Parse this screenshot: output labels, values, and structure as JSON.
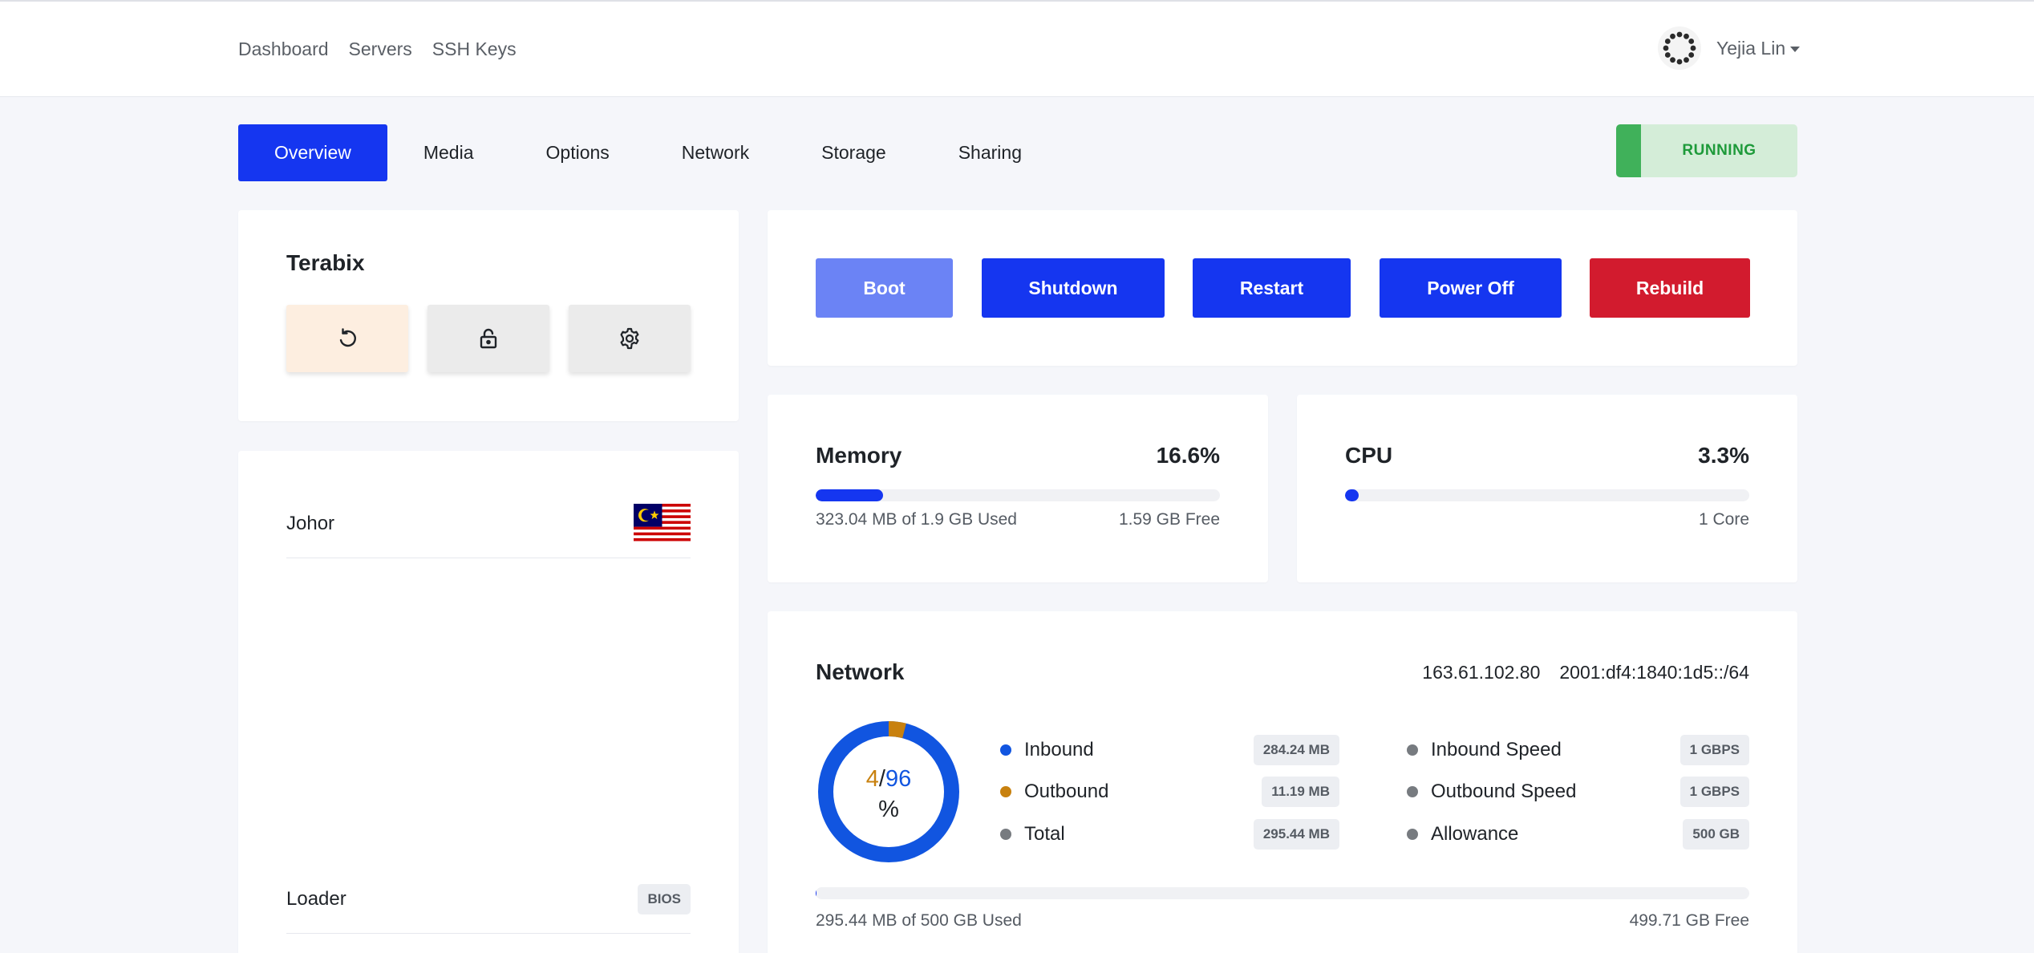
{
  "nav": {
    "links": [
      "Dashboard",
      "Servers",
      "SSH Keys"
    ],
    "user_name": "Yejia Lin"
  },
  "tabs": [
    {
      "label": "Overview",
      "active": true
    },
    {
      "label": "Media"
    },
    {
      "label": "Options"
    },
    {
      "label": "Network"
    },
    {
      "label": "Storage"
    },
    {
      "label": "Sharing"
    }
  ],
  "status": {
    "label": "RUNNING",
    "color": "#40b15a"
  },
  "server": {
    "name": "Terabix",
    "buttons": [
      {
        "icon": "refresh-icon",
        "bg": "#fdeee0"
      },
      {
        "icon": "lock-icon",
        "bg": "#ebebeb"
      },
      {
        "icon": "gear-icon",
        "bg": "#ebebeb"
      }
    ]
  },
  "location": {
    "city": "Johor",
    "flag": "malaysia-flag",
    "loader_label": "Loader",
    "loader_value": "BIOS"
  },
  "actions": [
    {
      "label": "Boot",
      "color": "#6b83f5"
    },
    {
      "label": "Shutdown",
      "color": "#1536f0"
    },
    {
      "label": "Restart",
      "color": "#1536f0"
    },
    {
      "label": "Power Off",
      "color": "#1536f0"
    },
    {
      "label": "Rebuild",
      "color": "#d21b2e"
    }
  ],
  "memory": {
    "title": "Memory",
    "percent_label": "16.6%",
    "fill_fraction": 0.166,
    "used_text": "323.04 MB of 1.9 GB Used",
    "free_text": "1.59 GB Free"
  },
  "cpu": {
    "title": "CPU",
    "percent_label": "3.3%",
    "fill_fraction": 0.033,
    "cores_text": "1 Core"
  },
  "network": {
    "title": "Network",
    "ipv4": "163.61.102.80",
    "ipv6": "2001:df4:1840:1d5::/64",
    "donut": {
      "outbound_pct": 4,
      "inbound_pct": 96,
      "sep": "/",
      "unit": "%",
      "inbound_color": "#1155e0",
      "outbound_color": "#c8810f"
    },
    "traffic": [
      {
        "name": "Inbound",
        "value": "284.24 MB",
        "color": "#1155e0"
      },
      {
        "name": "Outbound",
        "value": "11.19 MB",
        "color": "#c8810f"
      },
      {
        "name": "Total",
        "value": "295.44 MB",
        "color": "#777b80"
      }
    ],
    "limits": [
      {
        "name": "Inbound Speed",
        "value": "1 GBPS",
        "color": "#777b80"
      },
      {
        "name": "Outbound Speed",
        "value": "1 GBPS",
        "color": "#777b80"
      },
      {
        "name": "Allowance",
        "value": "500 GB",
        "color": "#777b80"
      }
    ],
    "usage_fill_fraction": 0.0006,
    "used_text": "295.44 MB of 500 GB Used",
    "free_text": "499.71 GB Free"
  }
}
